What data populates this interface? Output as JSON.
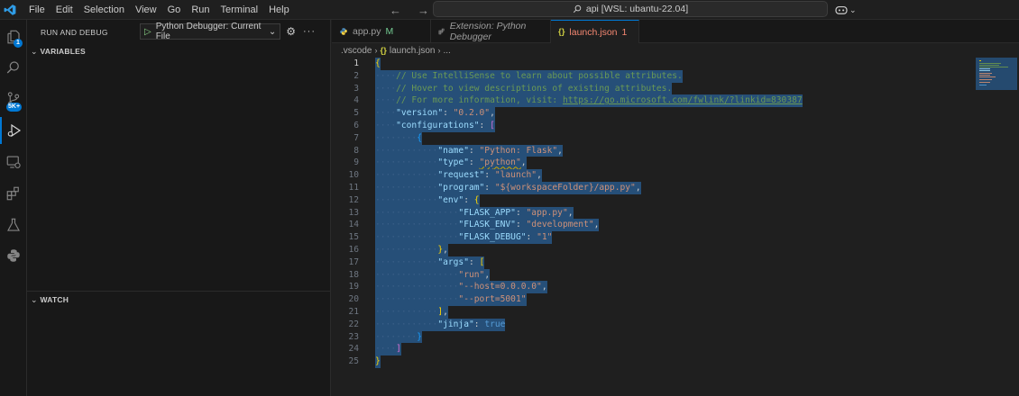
{
  "menu": [
    "File",
    "Edit",
    "Selection",
    "View",
    "Go",
    "Run",
    "Terminal",
    "Help"
  ],
  "command_center": {
    "text": "api [WSL: ubantu-22.04]"
  },
  "activity_bar": {
    "scm_badge": "5K+",
    "explorer_badge": "1"
  },
  "sidebar": {
    "title": "RUN AND DEBUG",
    "config_label": "Python Debugger: Current File",
    "sections": {
      "variables": "VARIABLES",
      "watch": "WATCH"
    }
  },
  "tabs": [
    {
      "label": "app.py",
      "status": "M"
    },
    {
      "label": "Extension: Python Debugger"
    },
    {
      "label": "launch.json",
      "status": "1"
    }
  ],
  "breadcrumb": {
    "folder": ".vscode",
    "file": "launch.json",
    "more": "..."
  },
  "editor": {
    "line_numbers": [
      "1",
      "2",
      "3",
      "4",
      "5",
      "6",
      "7",
      "8",
      "9",
      "10",
      "11",
      "12",
      "13",
      "14",
      "15",
      "16",
      "17",
      "18",
      "19",
      "20",
      "21",
      "22",
      "23",
      "24",
      "25"
    ],
    "code": {
      "l2": "// Use IntelliSense to learn about possible attributes.",
      "l3": "// Hover to view descriptions of existing attributes.",
      "l4_text": "// For more information, visit: ",
      "l4_link": "https://go.microsoft.com/fwlink/?linkid=830387",
      "version_key": "\"version\"",
      "version_val": "\"0.2.0\"",
      "configurations_key": "\"configurations\"",
      "name_key": "\"name\"",
      "name_val": "\"Python: Flask\"",
      "type_key": "\"type\"",
      "type_val": "\"python\"",
      "request_key": "\"request\"",
      "request_val": "\"launch\"",
      "program_key": "\"program\"",
      "program_val": "\"${workspaceFolder}/app.py\"",
      "env_key": "\"env\"",
      "flask_app_key": "\"FLASK_APP\"",
      "flask_app_val": "\"app.py\"",
      "flask_env_key": "\"FLASK_ENV\"",
      "flask_env_val": "\"development\"",
      "flask_debug_key": "\"FLASK_DEBUG\"",
      "flask_debug_val": "\"1\"",
      "args_key": "\"args\"",
      "arg1": "\"run\"",
      "arg2": "\"--host=0.0.0.0\"",
      "arg3": "\"--port=5001\"",
      "jinja_key": "\"jinja\"",
      "jinja_val": "true"
    }
  },
  "colors": {
    "accent": "#0078d4",
    "selection": "#264f78",
    "background": "#1f1f1f"
  }
}
